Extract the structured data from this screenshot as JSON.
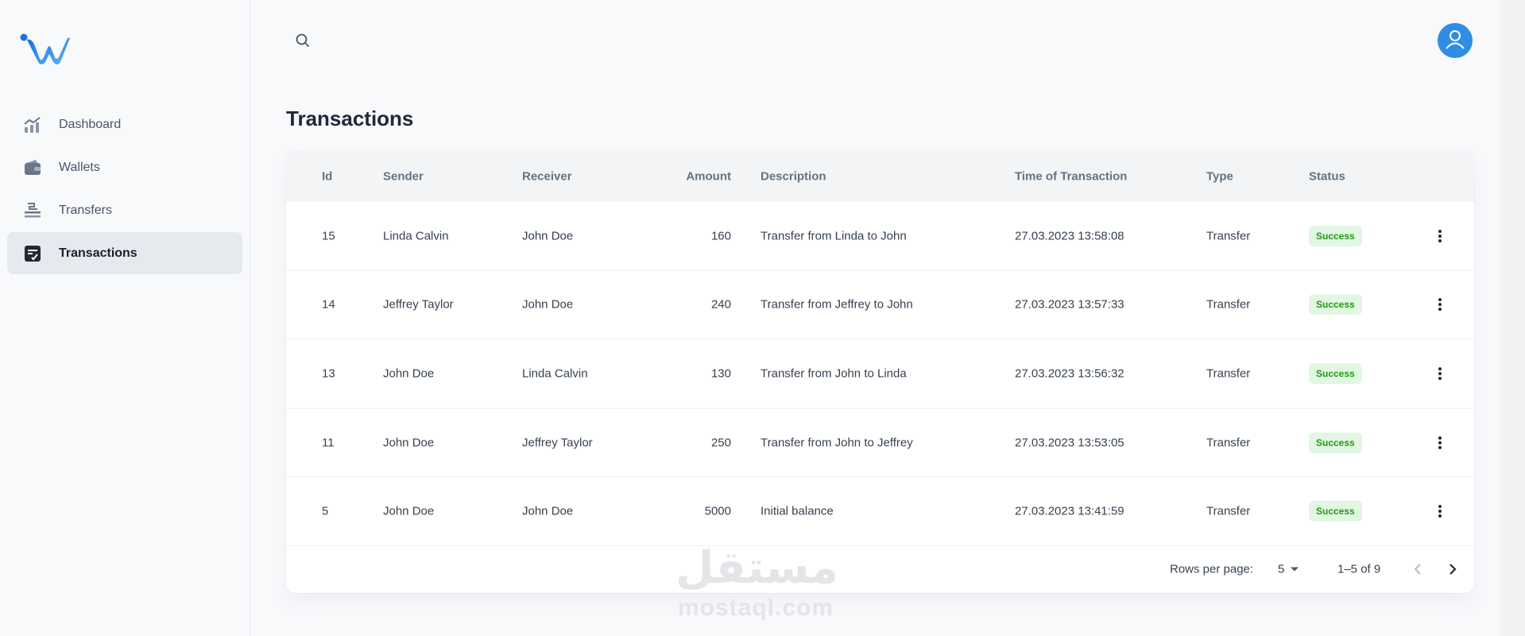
{
  "sidebar": {
    "items": [
      {
        "label": "Dashboard",
        "icon": "chart-icon"
      },
      {
        "label": "Wallets",
        "icon": "wallet-icon"
      },
      {
        "label": "Transfers",
        "icon": "transfer-icon"
      },
      {
        "label": "Transactions",
        "icon": "transactions-icon"
      }
    ],
    "active": "Transactions"
  },
  "page": {
    "title": "Transactions"
  },
  "table": {
    "headers": [
      "Id",
      "Sender",
      "Receiver",
      "Amount",
      "Description",
      "Time of Transaction",
      "Type",
      "Status"
    ],
    "rows": [
      {
        "id": "15",
        "sender": "Linda Calvin",
        "receiver": "John Doe",
        "amount": "160",
        "description": "Transfer from Linda to John",
        "time": "27.03.2023 13:58:08",
        "type": "Transfer",
        "status": "Success"
      },
      {
        "id": "14",
        "sender": "Jeffrey Taylor",
        "receiver": "John Doe",
        "amount": "240",
        "description": "Transfer from Jeffrey to John",
        "time": "27.03.2023 13:57:33",
        "type": "Transfer",
        "status": "Success"
      },
      {
        "id": "13",
        "sender": "John Doe",
        "receiver": "Linda Calvin",
        "amount": "130",
        "description": "Transfer from John to Linda",
        "time": "27.03.2023 13:56:32",
        "type": "Transfer",
        "status": "Success"
      },
      {
        "id": "11",
        "sender": "John Doe",
        "receiver": "Jeffrey Taylor",
        "amount": "250",
        "description": "Transfer from John to Jeffrey",
        "time": "27.03.2023 13:53:05",
        "type": "Transfer",
        "status": "Success"
      },
      {
        "id": "5",
        "sender": "John Doe",
        "receiver": "John Doe",
        "amount": "5000",
        "description": "Initial balance",
        "time": "27.03.2023 13:41:59",
        "type": "Transfer",
        "status": "Success"
      }
    ]
  },
  "pagination": {
    "rows_per_page_label": "Rows per page:",
    "rows_per_page": "5",
    "range": "1–5 of 9"
  },
  "watermark": {
    "arabic": "مستقل",
    "latin": "mostaql.com"
  },
  "colors": {
    "accent": "#2f8de4",
    "success_bg": "#e1f7e1",
    "success_text": "#229a16",
    "active_nav_bg": "#e6e9ed"
  }
}
